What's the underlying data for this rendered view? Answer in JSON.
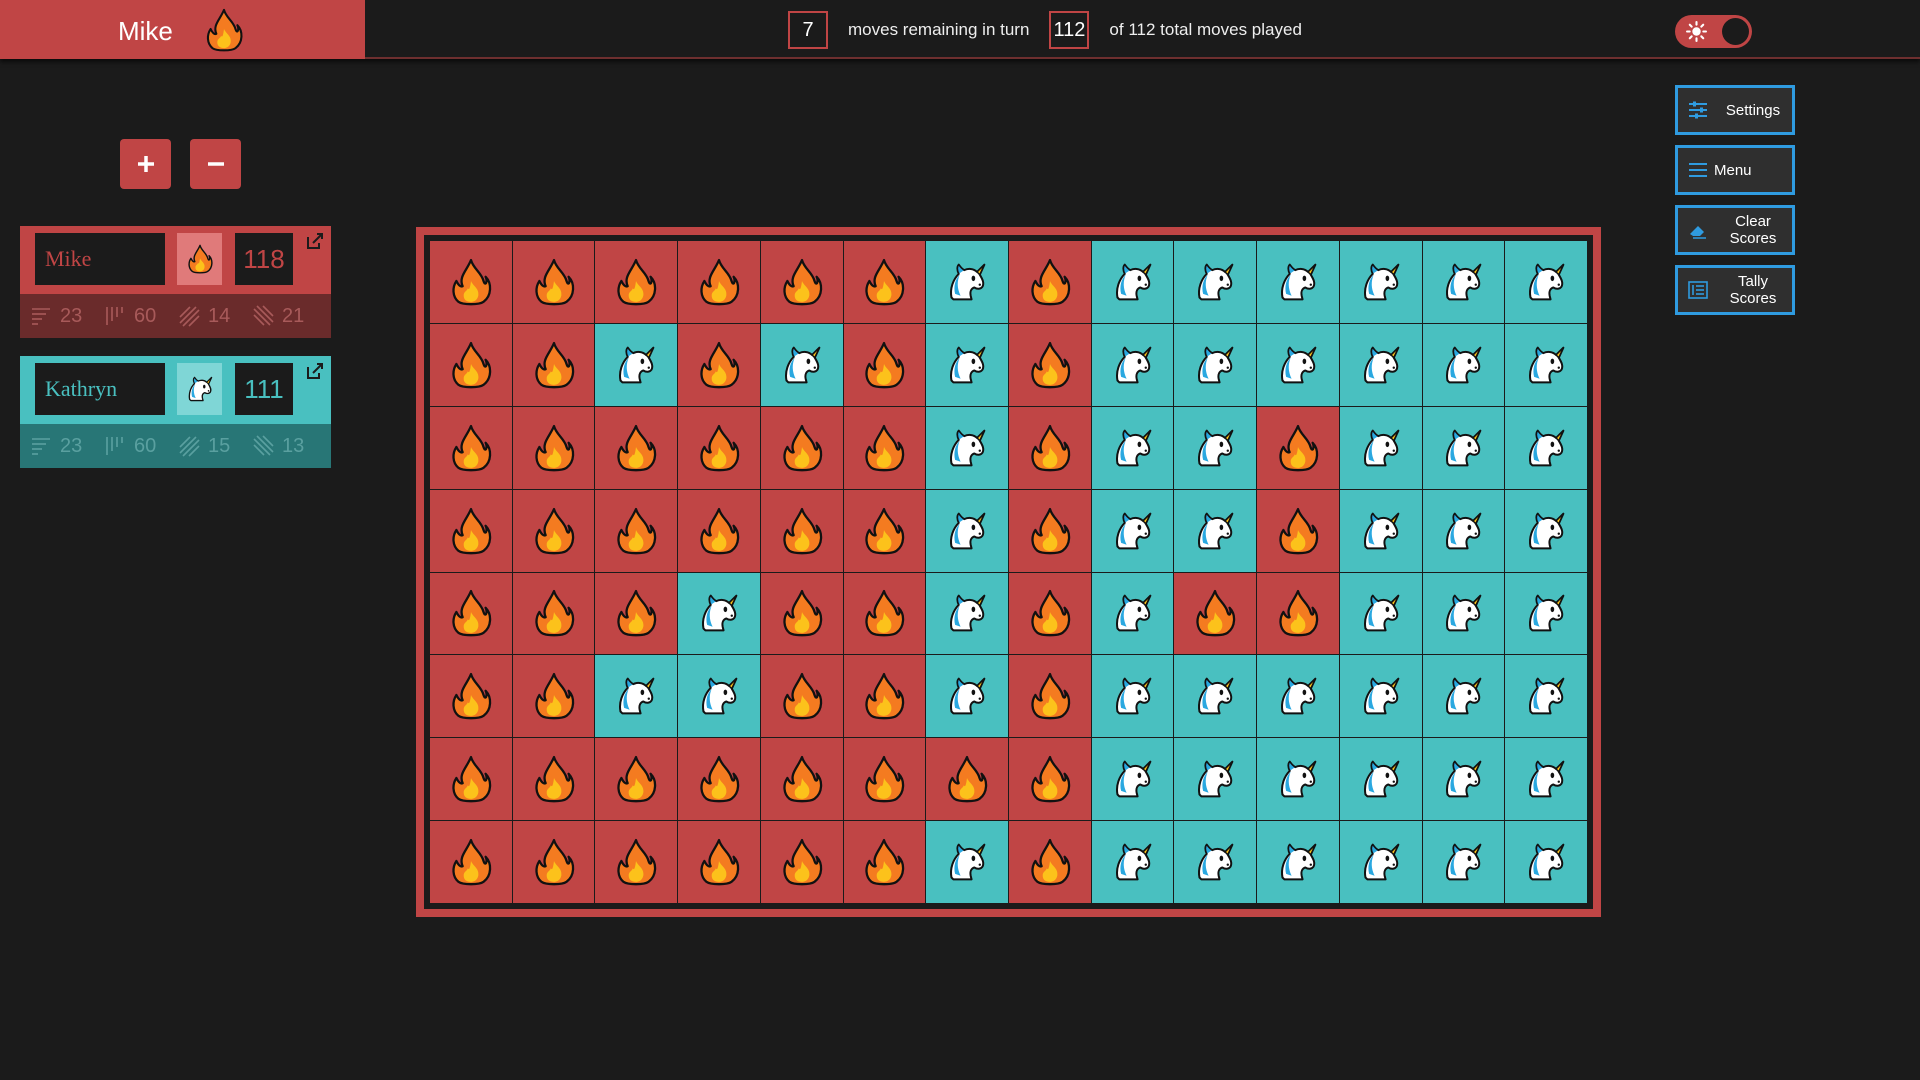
{
  "header": {
    "current_player": "Mike",
    "current_player_icon": "fire-icon",
    "moves_remaining": "7",
    "moves_remaining_label": "moves remaining in turn",
    "total_played": "112",
    "total_played_label": "of 112 total moves played"
  },
  "colors": {
    "fire": "#c04545",
    "unicorn": "#49c0c0",
    "accent": "#2f9be0",
    "background": "#1b1b1b"
  },
  "controls": {
    "add_player_label": "+",
    "remove_player_label": "−"
  },
  "players": [
    {
      "name": "Mike",
      "icon": "fire-icon",
      "score": "118",
      "stats": {
        "horizontal": "23",
        "vertical": "60",
        "diagonal_down": "14",
        "diagonal_up": "21"
      }
    },
    {
      "name": "Kathryn",
      "icon": "unicorn-icon",
      "score": "111",
      "stats": {
        "horizontal": "23",
        "vertical": "60",
        "diagonal_down": "15",
        "diagonal_up": "13"
      }
    }
  ],
  "side_menu": {
    "settings": "Settings",
    "menu": "Menu",
    "clear_scores": "Clear Scores",
    "tally_scores": "Tally Scores"
  },
  "board": {
    "rows": [
      "FFFFFFUFUUUUUU",
      "FFUFUFUFUUUUUU",
      "FFFFFFUFUUFUUU",
      "FFFFFFUFUUFUUU",
      "FFFUFFUFUFFUUU",
      "FFUUFFUFUUUUUU",
      "FFFFFFFFUUUUUU",
      "FFFFFFUFUUUUUU"
    ]
  }
}
